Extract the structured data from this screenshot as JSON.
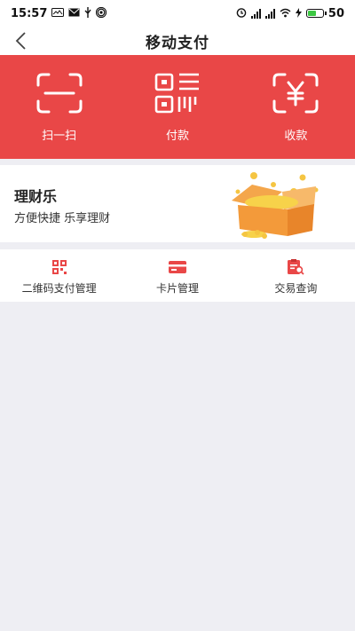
{
  "status_bar": {
    "time": "15:57",
    "battery_level": "50"
  },
  "nav": {
    "title": "移动支付"
  },
  "actions": [
    {
      "label": "扫一扫",
      "icon": "scan-icon"
    },
    {
      "label": "付款",
      "icon": "qr-pay-icon"
    },
    {
      "label": "收款",
      "icon": "receive-yuan-icon"
    }
  ],
  "banner": {
    "title": "理财乐",
    "subtitle": "方便快捷  乐享理财"
  },
  "menu": [
    {
      "label": "二维码支付管理",
      "icon": "qr-manage-icon"
    },
    {
      "label": "卡片管理",
      "icon": "card-icon"
    },
    {
      "label": "交易查询",
      "icon": "transaction-search-icon"
    }
  ],
  "colors": {
    "accent": "#e94747",
    "background": "#eeeef3"
  }
}
